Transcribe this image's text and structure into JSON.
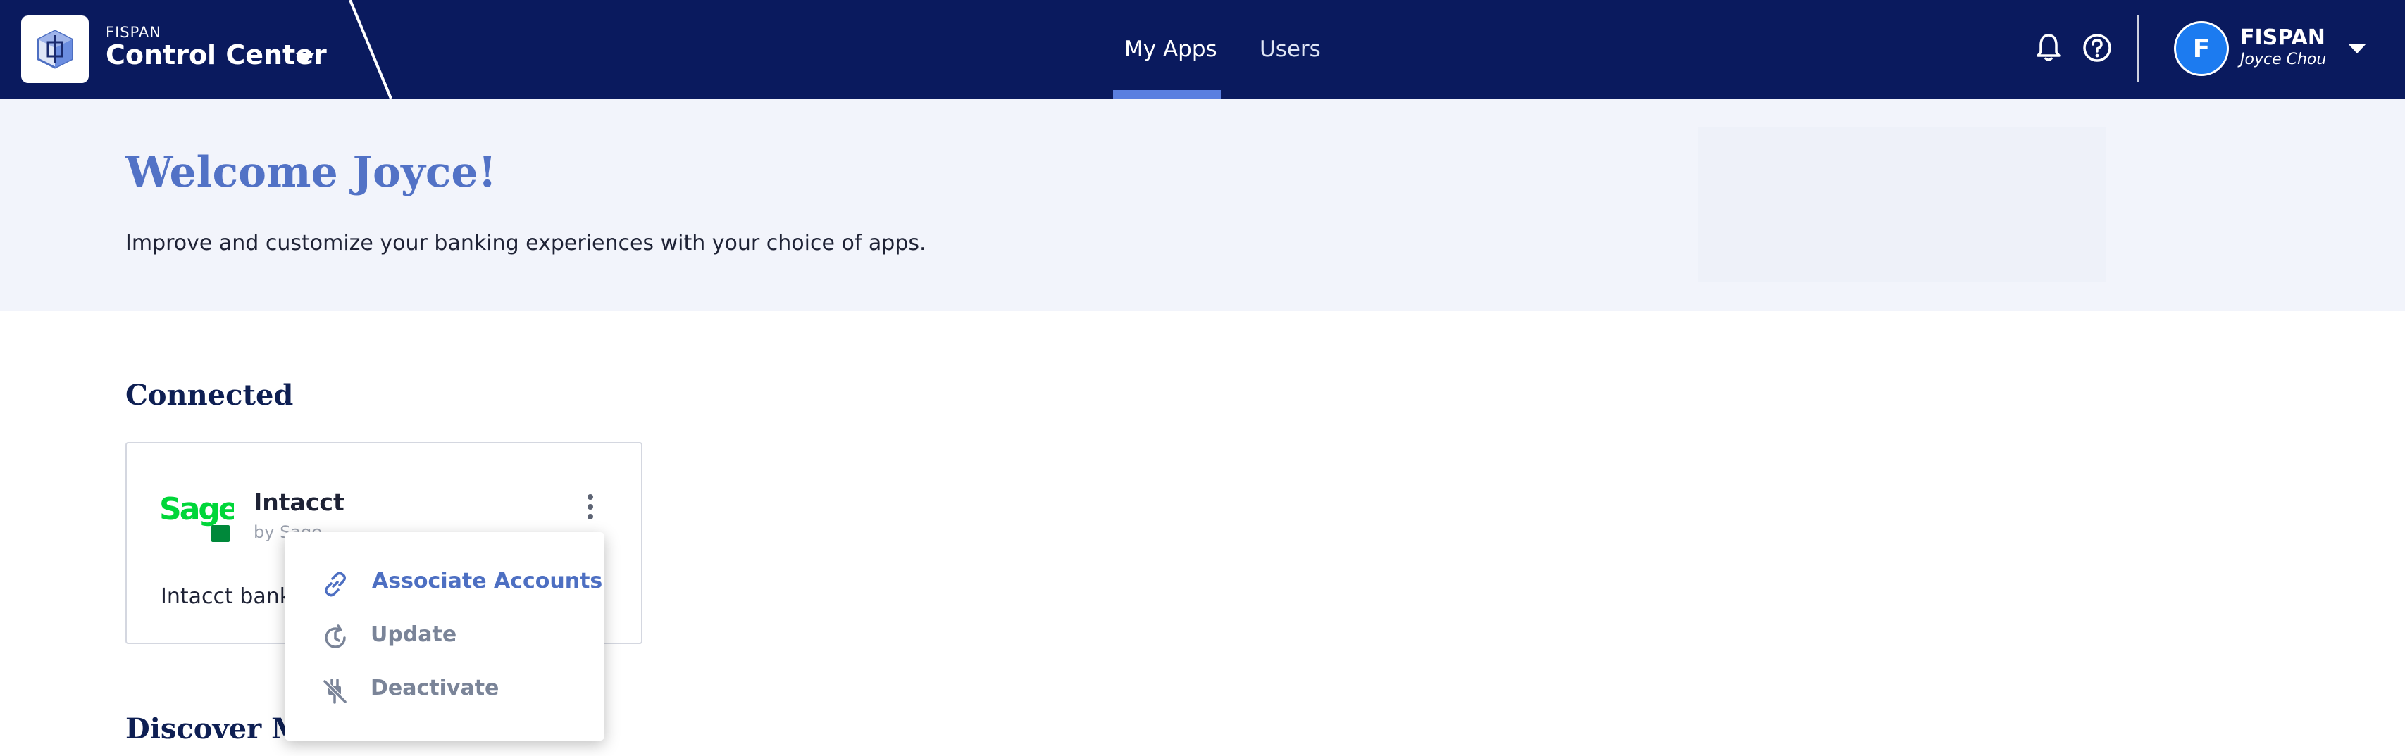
{
  "header": {
    "brand_small": "FISPAN",
    "brand_title": "Control Center",
    "nav": [
      {
        "label": "My Apps",
        "active": true
      },
      {
        "label": "Users",
        "active": false
      }
    ],
    "icons": [
      "bell-icon",
      "help-icon"
    ],
    "user": {
      "avatar_letter": "F",
      "org": "FISPAN",
      "name": "Joyce Chou"
    }
  },
  "hero": {
    "title": "Welcome Joyce!",
    "subtitle": "Improve and customize your banking experiences with your choice of apps."
  },
  "connected": {
    "title": "Connected",
    "apps": [
      {
        "name": "Intacct",
        "by": "by Sage",
        "description": "Intacct bank",
        "logo": "sage-logo"
      }
    ]
  },
  "menu": {
    "items": [
      {
        "label": "Associate Accounts",
        "icon": "link-icon"
      },
      {
        "label": "Update",
        "icon": "update-icon"
      },
      {
        "label": "Deactivate",
        "icon": "unplug-icon"
      }
    ]
  },
  "discover": {
    "title": "Discover More"
  },
  "colors": {
    "navbar": "#0a1a5e",
    "accent": "#5272c6",
    "hero_bg": "#f2f4fb",
    "sage_green": "#00d639"
  }
}
